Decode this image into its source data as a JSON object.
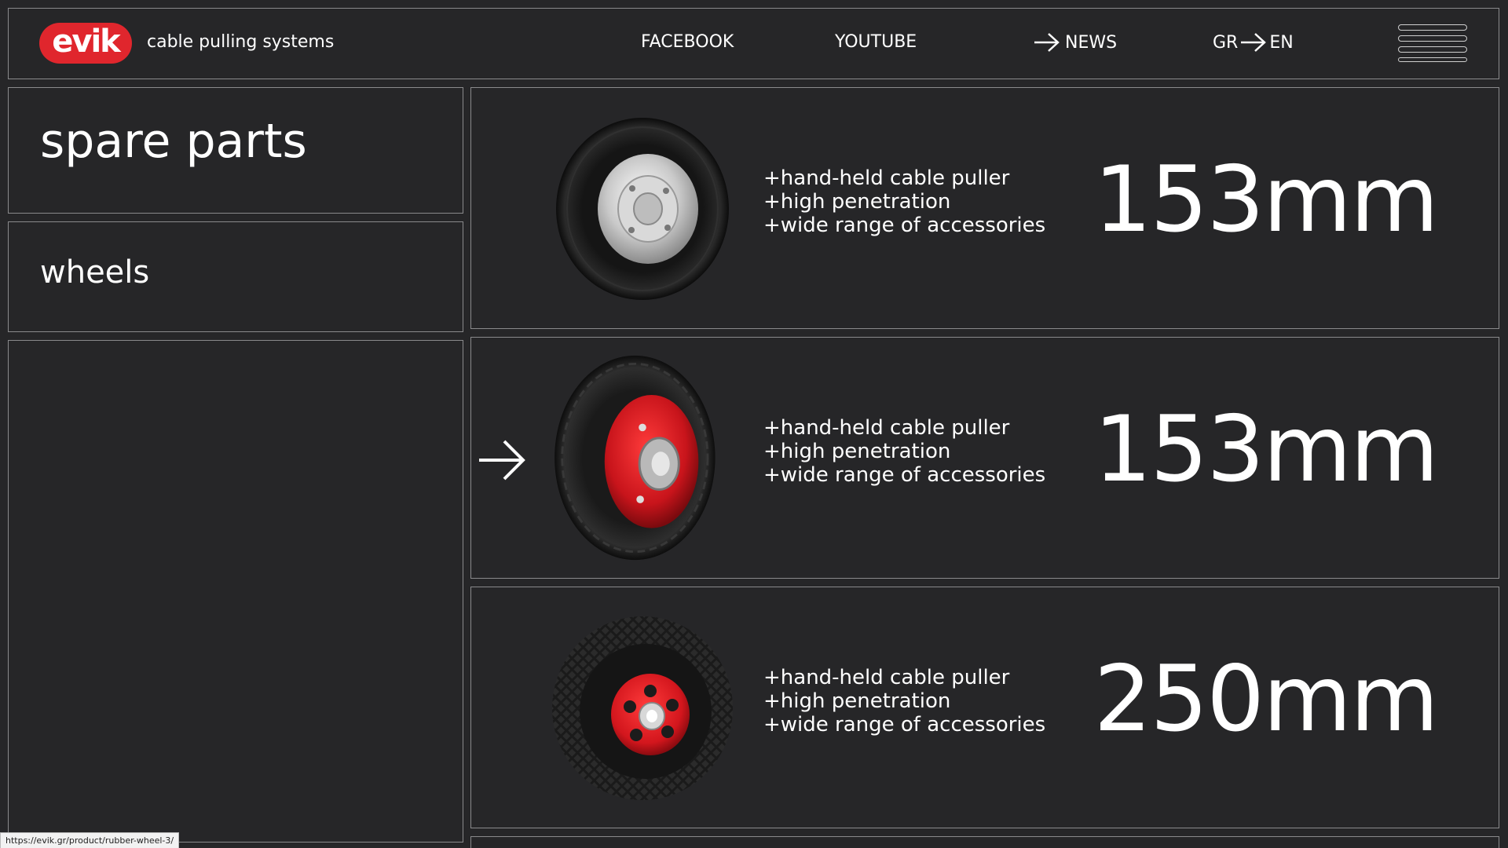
{
  "header": {
    "logo_text": "evik",
    "tagline": "cable pulling systems",
    "nav": {
      "facebook": "FACEBOOK",
      "youtube": "YOUTUBE",
      "news": "NEWS",
      "lang_from": "GR",
      "lang_to": "EN"
    },
    "menu_icon": "hamburger-menu-icon",
    "brand_color": "#e0262d"
  },
  "sidebar": {
    "title": "spare parts",
    "category": "wheels"
  },
  "products": [
    {
      "features": [
        "+hand-held cable puller",
        "+high penetration",
        "+wide range of accessories"
      ],
      "size": "153mm",
      "image": "black-wheel-silver-hub"
    },
    {
      "features": [
        "+hand-held cable puller",
        "+high penetration",
        "+wide range of accessories"
      ],
      "size": "153mm",
      "image": "black-wheel-red-hub"
    },
    {
      "features": [
        "+hand-held cable puller",
        "+high penetration",
        "+wide range of accessories"
      ],
      "size": "250mm",
      "image": "treaded-wheel-red-hub"
    }
  ],
  "status_bar": {
    "url": "https://evik.gr/product/rubber-wheel-3/"
  }
}
